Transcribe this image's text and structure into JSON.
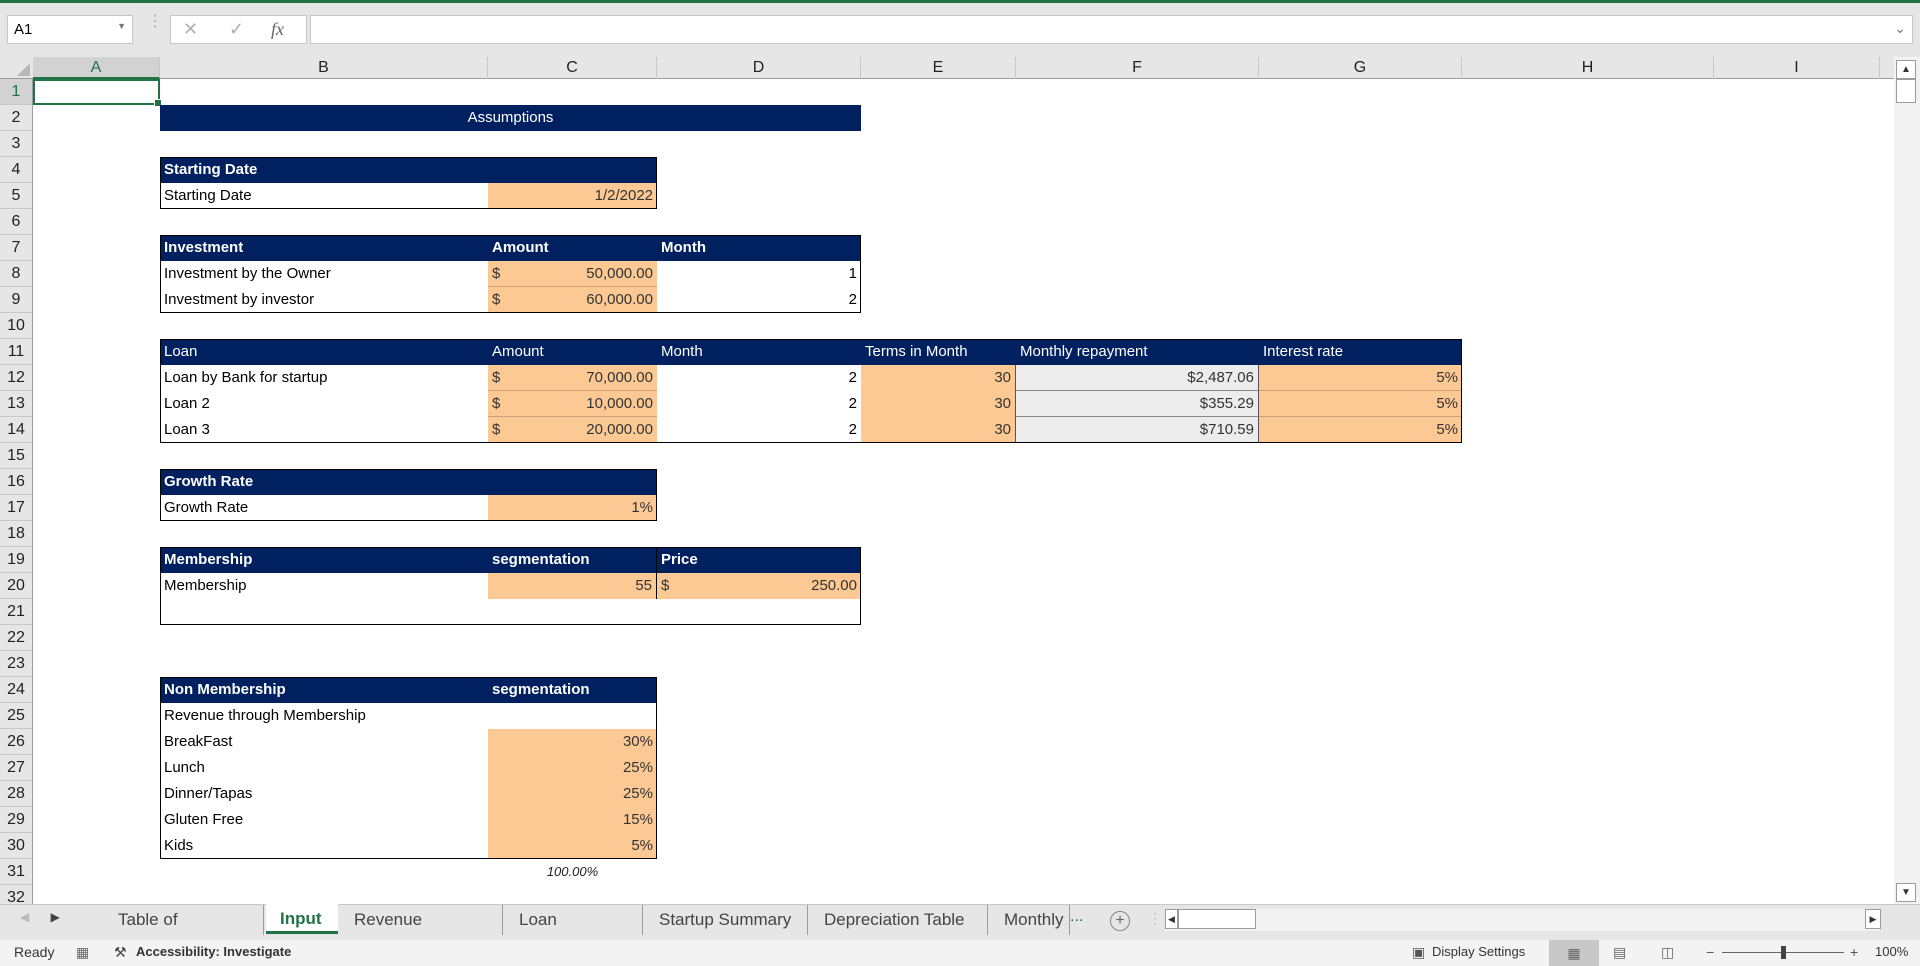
{
  "formula_bar": {
    "name_box": "A1",
    "cancel_icon": "✕",
    "enter_icon": "✓",
    "fx_label": "fx",
    "formula": ""
  },
  "columns": [
    "A",
    "B",
    "C",
    "D",
    "E",
    "F",
    "G",
    "H",
    "I"
  ],
  "rows": [
    "1",
    "2",
    "3",
    "4",
    "5",
    "6",
    "7",
    "8",
    "9",
    "10",
    "11",
    "12",
    "13",
    "14",
    "15",
    "16",
    "17",
    "18",
    "19",
    "20",
    "21",
    "22",
    "23",
    "24",
    "25",
    "26",
    "27",
    "28",
    "29",
    "30",
    "31",
    "32"
  ],
  "sheet": {
    "title": "Assumptions",
    "starting_date": {
      "header": "Starting Date",
      "label": "Starting Date",
      "value": "1/2/2022"
    },
    "investment": {
      "headers": [
        "Investment",
        "Amount",
        "Month"
      ],
      "rows": [
        {
          "label": "Investment by the Owner",
          "currency": "$",
          "amount": "50,000.00",
          "month": "1"
        },
        {
          "label": "Investment by investor",
          "currency": "$",
          "amount": "60,000.00",
          "month": "2"
        }
      ]
    },
    "loan": {
      "headers": [
        "Loan",
        "Amount",
        "Month",
        "Terms in Month",
        "Monthly repayment",
        "Interest rate"
      ],
      "rows": [
        {
          "label": "Loan by Bank for startup",
          "currency": "$",
          "amount": "70,000.00",
          "month": "2",
          "terms": "30",
          "repayment": "$2,487.06",
          "rate": "5%"
        },
        {
          "label": "Loan 2",
          "currency": "$",
          "amount": "10,000.00",
          "month": "2",
          "terms": "30",
          "repayment": "$355.29",
          "rate": "5%"
        },
        {
          "label": "Loan 3",
          "currency": "$",
          "amount": "20,000.00",
          "month": "2",
          "terms": "30",
          "repayment": "$710.59",
          "rate": "5%"
        }
      ]
    },
    "growth": {
      "header": "Growth Rate",
      "label": "Growth Rate",
      "value": "1%"
    },
    "membership": {
      "headers": [
        "Membership",
        "segmentation",
        "Price"
      ],
      "label": "Membership",
      "segmentation": "55",
      "currency": "$",
      "price": "250.00"
    },
    "non_membership": {
      "headers": [
        "Non Membership",
        "segmentation"
      ],
      "subtitle": "Revenue through Membership",
      "rows": [
        {
          "label": "BreakFast",
          "value": "30%"
        },
        {
          "label": "Lunch",
          "value": "25%"
        },
        {
          "label": "Dinner/Tapas",
          "value": "25%"
        },
        {
          "label": "Gluten Free",
          "value": "15%"
        },
        {
          "label": "Kids",
          "value": "5%"
        }
      ],
      "total": "100.00%"
    }
  },
  "tabs": [
    {
      "label": "Table of Contents"
    },
    {
      "label": "Input",
      "active": true
    },
    {
      "label": "Revenue Analysis"
    },
    {
      "label": "Loan Schedule"
    },
    {
      "label": "Startup Summary"
    },
    {
      "label": "Depreciation Table"
    },
    {
      "label": "Monthly"
    }
  ],
  "tab_more": "...",
  "status": {
    "ready": "Ready",
    "accessibility": "Accessibility: Investigate",
    "display_settings": "Display Settings",
    "zoom": "100%"
  },
  "colors": {
    "header_fill": "#002060",
    "input_fill": "#fcc994",
    "calc_fill": "#ececec",
    "accent": "#217346"
  }
}
